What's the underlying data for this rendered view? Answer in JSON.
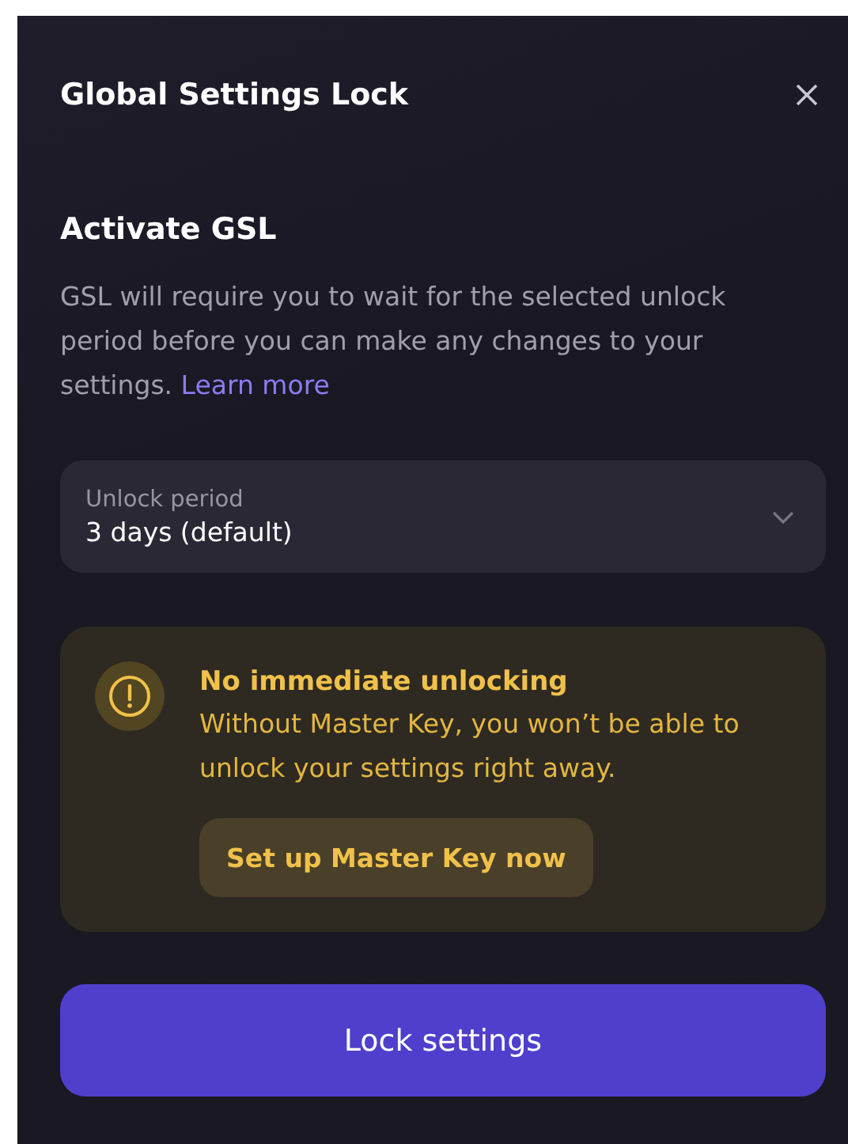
{
  "dialog": {
    "title": "Global Settings Lock"
  },
  "section": {
    "heading": "Activate GSL",
    "description": "GSL will require you to wait for the selected unlock period before you can make any changes to your settings.",
    "link": "Learn more"
  },
  "select": {
    "label": "Unlock period",
    "value": "3 days (default)"
  },
  "warning": {
    "title": "No immediate unlocking",
    "message": "Without Master Key, you won’t be able to unlock your settings right away.",
    "action": "Set up Master Key now"
  },
  "primary_button": "Lock settings"
}
